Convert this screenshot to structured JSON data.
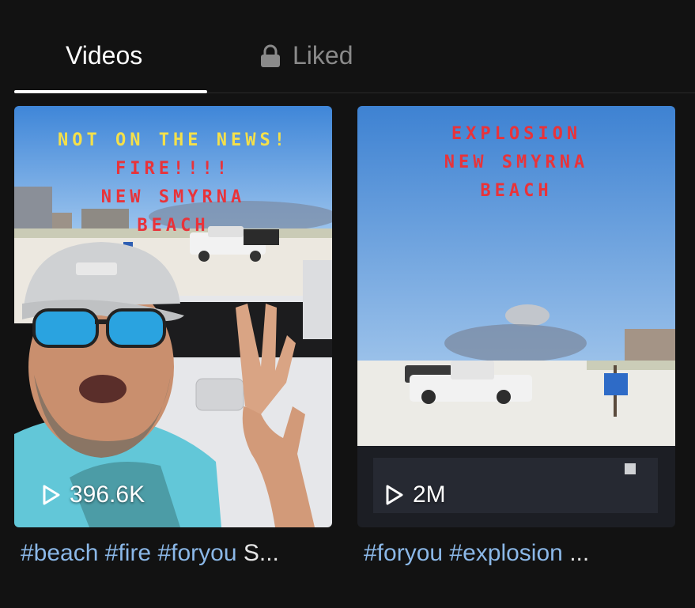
{
  "tabs": {
    "videos_label": "Videos",
    "liked_label": "Liked",
    "liked_icon": "lock-icon"
  },
  "videos": [
    {
      "overlay": [
        {
          "text": "NOT ON THE NEWS!",
          "color": "#f4e04a"
        },
        {
          "text": "FIRE!!!!",
          "color": "#e8333a"
        },
        {
          "text": "NEW SMYRNA",
          "color": "#e8333a"
        },
        {
          "text": "BEACH",
          "color": "#e8333a"
        }
      ],
      "views": "396.6K",
      "caption_tags": "#beach #fire #foryou",
      "caption_rest": "S..."
    },
    {
      "overlay": [
        {
          "text": "EXPLOSION",
          "color": "#e8333a"
        },
        {
          "text": "NEW SMYRNA",
          "color": "#e8333a"
        },
        {
          "text": "BEACH",
          "color": "#e8333a"
        }
      ],
      "views": "2M",
      "caption_tags": "#foryou #explosion",
      "caption_rest": "..."
    }
  ]
}
